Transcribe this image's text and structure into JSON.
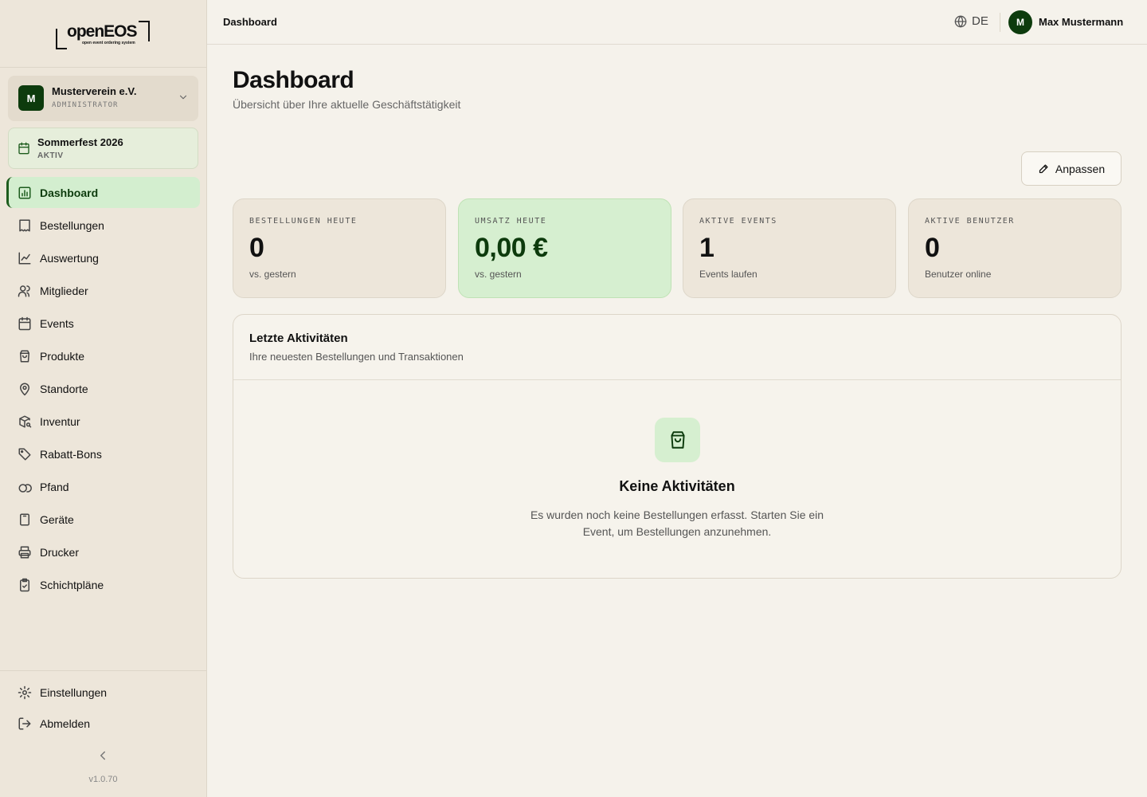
{
  "brand": {
    "logo_text": "openEOS",
    "logo_tagline": "open event ordering system",
    "version": "v1.0.70"
  },
  "org": {
    "avatar": "M",
    "name": "Musterverein e.V.",
    "role": "ADMINISTRATOR"
  },
  "event": {
    "name": "Sommerfest 2026",
    "status": "AKTIV"
  },
  "nav": {
    "items": [
      {
        "label": "Dashboard",
        "icon": "chart-bar-icon",
        "active": true
      },
      {
        "label": "Bestellungen",
        "icon": "receipt-icon"
      },
      {
        "label": "Auswertung",
        "icon": "line-chart-icon"
      },
      {
        "label": "Mitglieder",
        "icon": "users-icon"
      },
      {
        "label": "Events",
        "icon": "calendar-icon"
      },
      {
        "label": "Produkte",
        "icon": "shopping-bag-icon"
      },
      {
        "label": "Standorte",
        "icon": "map-pin-icon"
      },
      {
        "label": "Inventur",
        "icon": "package-search-icon"
      },
      {
        "label": "Rabatt-Bons",
        "icon": "tag-icon"
      },
      {
        "label": "Pfand",
        "icon": "coins-icon"
      },
      {
        "label": "Geräte",
        "icon": "tablet-icon"
      },
      {
        "label": "Drucker",
        "icon": "printer-icon"
      },
      {
        "label": "Schichtpläne",
        "icon": "clipboard-check-icon"
      }
    ],
    "settings": "Einstellungen",
    "logout": "Abmelden"
  },
  "header": {
    "breadcrumb": "Dashboard",
    "language": "DE",
    "user_avatar": "M",
    "user_name": "Max Mustermann"
  },
  "page": {
    "title": "Dashboard",
    "subtitle": "Übersicht über Ihre aktuelle Geschäftstätigkeit",
    "customize_label": "Anpassen"
  },
  "kpis": [
    {
      "label": "BESTELLUNGEN HEUTE",
      "value": "0",
      "note": "vs. gestern"
    },
    {
      "label": "UMSATZ HEUTE",
      "value": "0,00 €",
      "note": "vs. gestern"
    },
    {
      "label": "AKTIVE EVENTS",
      "value": "1",
      "note": "Events laufen"
    },
    {
      "label": "AKTIVE BENUTZER",
      "value": "0",
      "note": "Benutzer online"
    }
  ],
  "activity": {
    "title": "Letzte Aktivitäten",
    "subtitle": "Ihre neuesten Bestellungen und Transaktionen",
    "empty_title": "Keine Aktivitäten",
    "empty_text": "Es wurden noch keine Bestellungen erfasst. Starten Sie ein Event, um Bestellungen anzunehmen."
  },
  "colors": {
    "accent": "#0d3b0d",
    "active_bg": "#d3eecf",
    "sidebar_bg": "#ede6da",
    "page_bg": "#f5f2eb"
  }
}
